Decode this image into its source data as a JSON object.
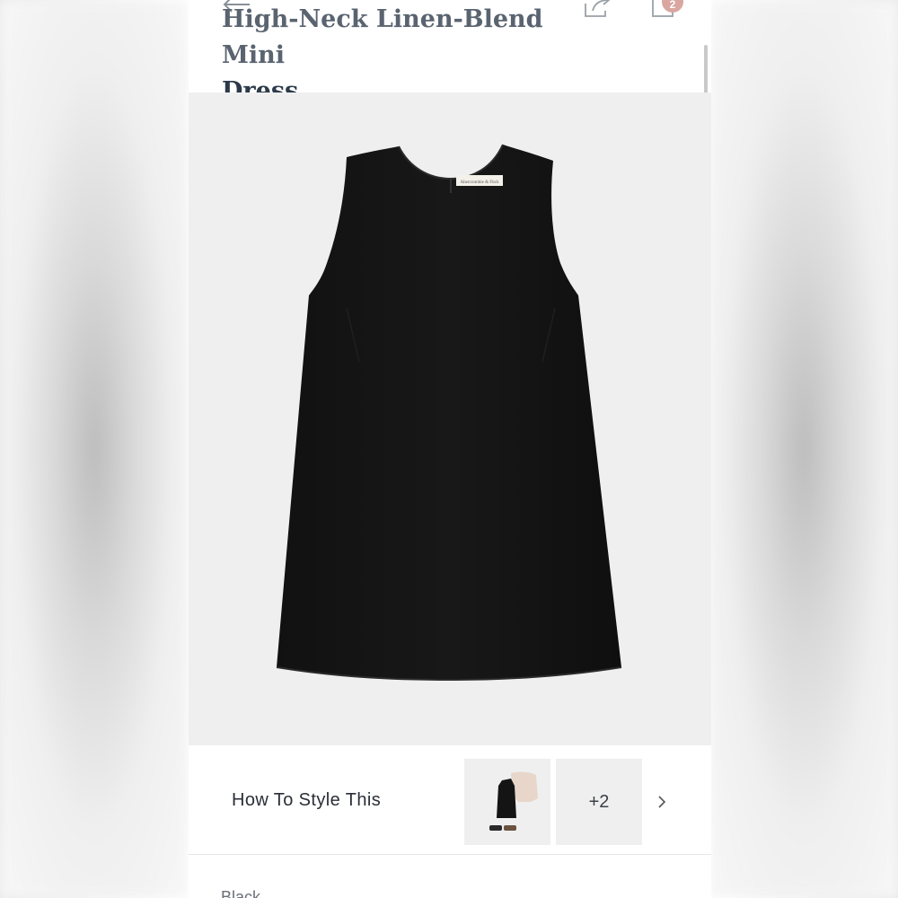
{
  "header": {
    "title_line1": "High-Neck Linen-Blend Mini",
    "title_line2": "Dress",
    "bag_count": "2"
  },
  "product": {
    "image_icon": "dress-photo",
    "label_text": "Abercrombie & Fitch"
  },
  "style_section": {
    "label": "How To Style This",
    "more_count": "+2"
  },
  "next_section": {
    "partial_text": "Black"
  },
  "colors": {
    "title": "#2c3a4a",
    "badge": "#d9a7a0",
    "image_bg": "#efefef"
  }
}
